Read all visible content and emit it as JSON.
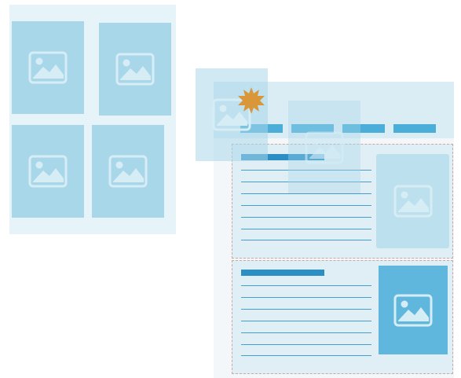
{
  "colors": {
    "gallery_bg": "#e6f4fa",
    "thumb": "#a9d7ea",
    "layout_bg": "#f3f7fa",
    "header_bg": "#daecf4",
    "nav": "#4aaed9",
    "heading": "#2b8ec5",
    "image_solid": "#5fb7de",
    "burst": "#d9973a",
    "dashed_border": "#c9a9a0"
  },
  "gallery": {
    "thumbnails": [
      {
        "icon": "image-icon"
      },
      {
        "icon": "image-icon"
      },
      {
        "icon": "image-icon"
      },
      {
        "icon": "image-icon"
      }
    ]
  },
  "layout": {
    "nav_items": 4,
    "content_blocks": [
      {
        "text_lines": 7,
        "image": "image-icon"
      },
      {
        "text_lines": 7,
        "image": "image-icon"
      }
    ]
  },
  "badge": {
    "icon": "starburst-icon"
  }
}
